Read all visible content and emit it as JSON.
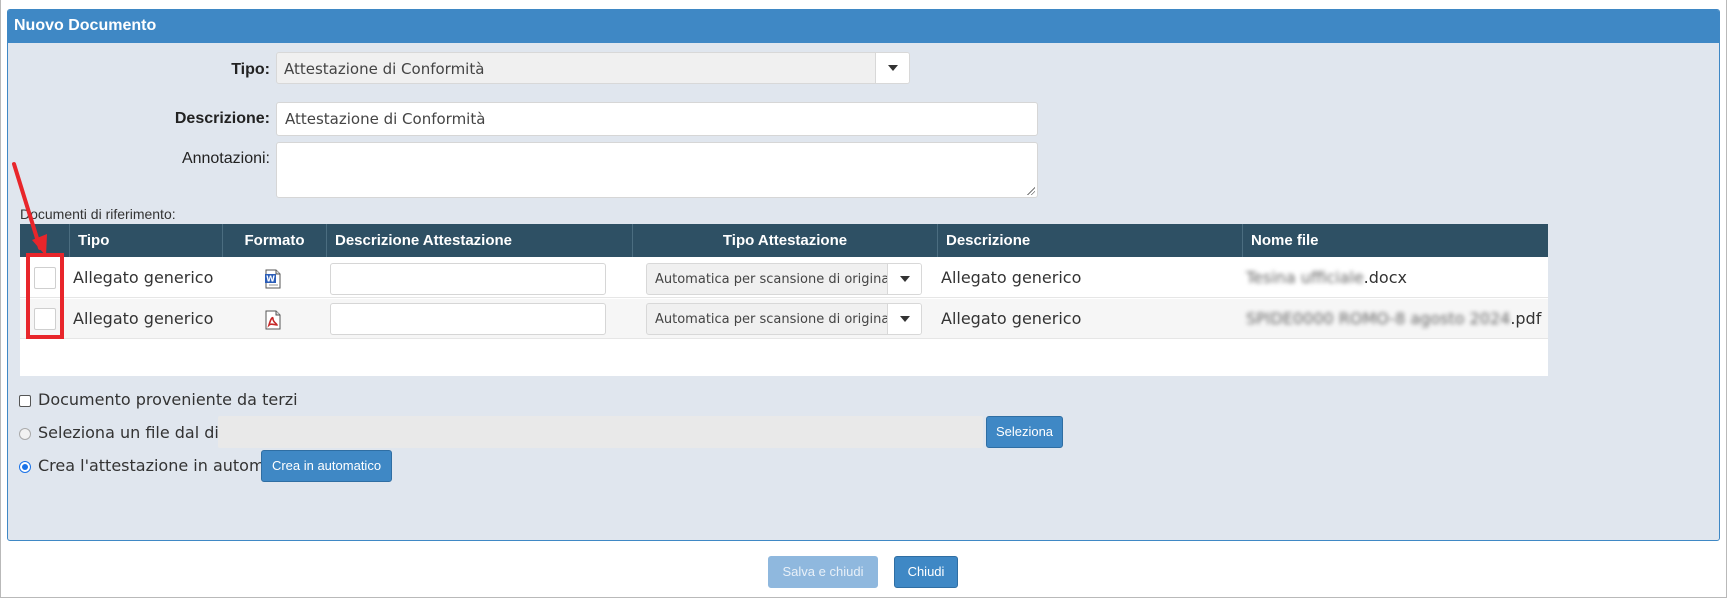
{
  "dialog": {
    "title": "Nuovo Documento"
  },
  "form": {
    "tipo_label": "Tipo:",
    "tipo_value": "Attestazione di Conformità",
    "descrizione_label": "Descrizione:",
    "descrizione_value": "Attestazione di Conformità",
    "annotazioni_label": "Annotazioni:",
    "annotazioni_value": ""
  },
  "references": {
    "label": "Documenti di riferimento:",
    "columns": [
      "",
      "Tipo",
      "Formato",
      "Descrizione Attestazione",
      "Tipo Attestazione",
      "Descrizione",
      "Nome file"
    ],
    "rows": [
      {
        "tipo": "Allegato generico",
        "formato": "word-doc-icon",
        "descrizione_attestazione": "",
        "tipo_attestazione": "Automatica per scansione di originale",
        "descrizione": "Allegato generico",
        "nome_file_blurred": "Tesina ufficiale",
        "nome_file_ext": ".docx"
      },
      {
        "tipo": "Allegato generico",
        "formato": "pdf-doc-icon",
        "descrizione_attestazione": "",
        "tipo_attestazione": "Automatica per scansione di originale",
        "descrizione": "Allegato generico",
        "nome_file_blurred": "SPIDE0000 ROMO-8 agosto 2024",
        "nome_file_ext": ".pdf"
      }
    ]
  },
  "options": {
    "terzi_label": "Documento proveniente da terzi",
    "seleziona_file_label": "Seleziona un file dal disco:",
    "seleziona_button": "Seleziona",
    "crea_auto_label": "Crea l'attestazione in automatico",
    "crea_auto_button": "Crea in automatico"
  },
  "footer": {
    "save_label": "Salva e chiudi",
    "close_label": "Chiudi"
  },
  "colors": {
    "header": "#3f88c5",
    "table_head": "#2e5064",
    "panel_bg": "#e0e6ee",
    "highlight": "#e8262b"
  }
}
